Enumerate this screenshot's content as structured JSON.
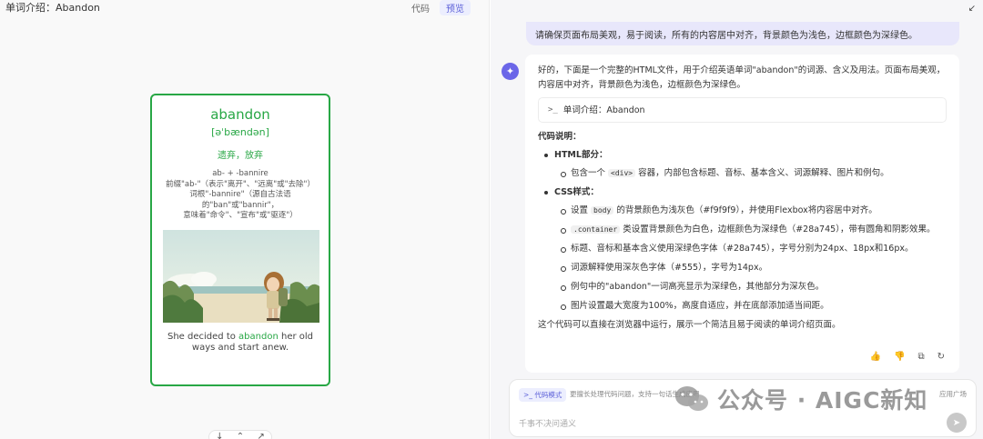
{
  "left": {
    "title": "单词介绍：Abandon",
    "tabs": [
      {
        "label": "代码"
      },
      {
        "label": "预览"
      }
    ],
    "card": {
      "word": "abandon",
      "phonetic": "[əˈbændən]",
      "meaning": "遗弃，放弃",
      "etymology": [
        "ab- + -bannire",
        "前缀\"ab-\"（表示\"离开\"、\"远离\"或\"去除\"）",
        "词根\"-bannire\"（源自古法语的\"ban\"或\"bannir\"，",
        "意味着\"命令\"、\"宣布\"或\"驱逐\"）"
      ],
      "example_before": "She decided to ",
      "example_highlight": "abandon",
      "example_after": " her old ways and start anew."
    },
    "tools": [
      "↓",
      "⌃",
      "↗"
    ]
  },
  "right": {
    "collapse_icon": "↙",
    "user_message": "请确保页面布局美观，易于阅读，所有的内容居中对齐，背景颜色为浅色，边框颜色为深绿色。",
    "bot_avatar": "✦",
    "bot": {
      "intro": "好的，下面是一个完整的HTML文件，用于介绍英语单词\"abandon\"的词源、含义及用法。页面布局美观，内容居中对齐，背景颜色为浅色，边框颜色为深绿色。",
      "code_ref_prompt": ">_",
      "code_ref": "单词介绍：Abandon",
      "explain_title": "代码说明：",
      "html_section": "HTML部分：",
      "html_item_a": "包含一个 ",
      "html_item_code": "<div>",
      "html_item_b": " 容器，内部包含标题、音标、基本含义、词源解释、图片和例句。",
      "css_section": "CSS样式：",
      "css1_a": "设置 ",
      "css1_code": "body",
      "css1_b": " 的背景颜色为浅灰色（#f9f9f9），并使用Flexbox将内容居中对齐。",
      "css2_code": ".container",
      "css2_b": " 类设置背景颜色为白色，边框颜色为深绿色（#28a745），带有圆角和阴影效果。",
      "css3": "标题、音标和基本含义使用深绿色字体（#28a745），字号分别为24px、18px和16px。",
      "css4": "词源解释使用深灰色字体（#555），字号为14px。",
      "css5": "例句中的\"abandon\"一词高亮显示为深绿色，其他部分为深灰色。",
      "css6": "图片设置最大宽度为100%，高度自适应，并在底部添加适当间距。",
      "summary": "这个代码可以直接在浏览器中运行，展示一个简洁且易于阅读的单词介绍页面。",
      "actions": [
        "👍",
        "👎",
        "⧉",
        "↻"
      ]
    },
    "input": {
      "mode_chip": ">_ 代码模式",
      "mode_hint": "更擅长处理代码问题，支持一句话生成应用",
      "plaza": "应用广场",
      "placeholder": "千事不决问通义",
      "send_icon": "➤"
    }
  },
  "watermark": {
    "text": "公众号 · AIGC新知"
  },
  "colors": {
    "accent_green": "#28a745",
    "accent_purple": "#5b5fd8",
    "user_bubble": "#e8e7fb"
  }
}
